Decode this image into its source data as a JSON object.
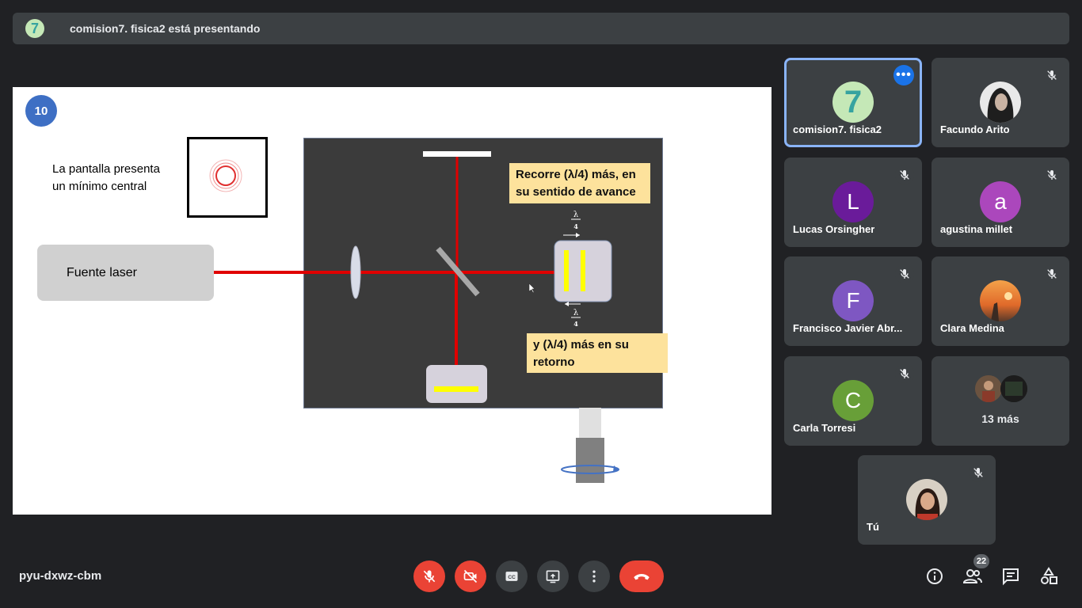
{
  "presenting_bar": {
    "text": "comision7. fisica2 está presentando",
    "avatar_icon": "comision7-logo-icon"
  },
  "slide": {
    "number": "10",
    "screen_text_line1": "La pantalla presenta",
    "screen_text_line2": "un mínimo central",
    "laser_label": "Fuente  laser",
    "callout1_line1": "Recorre (λ/4) más, en",
    "callout1_line2": "su sentido de avance",
    "callout2_line1": "y (λ/4) más en su",
    "callout2_line2": "retorno",
    "lambda_top_num": "λ",
    "lambda_top_den": "4",
    "lambda_bottom_num": "λ",
    "lambda_bottom_den": "4",
    "colors": {
      "laser": "#e00000",
      "panel": "#3b3b3b",
      "mirror": "#ffff00",
      "callout": "#fde29c"
    }
  },
  "participants": [
    {
      "name": "comision7. fisica2",
      "avatar": "7",
      "avatar_color": "#c5e8b7",
      "active": true,
      "more_options": "•••"
    },
    {
      "name": "Facundo Arito",
      "avatar": "",
      "avatar_color": "#2a2a2a",
      "muted": true
    },
    {
      "name": "Lucas Orsingher",
      "avatar": "L",
      "avatar_color": "#6a1b9a",
      "muted": true
    },
    {
      "name": "agustina millet",
      "avatar": "a",
      "avatar_color": "#ab47bc",
      "muted": true
    },
    {
      "name": "Francisco Javier Abr...",
      "avatar": "F",
      "avatar_color": "#7e57c2",
      "muted": true
    },
    {
      "name": "Clara Medina",
      "avatar": "",
      "avatar_color": "#e07b39",
      "muted": true
    },
    {
      "name": "Carla Torresi",
      "avatar": "C",
      "avatar_color": "#689f38",
      "muted": true
    },
    {
      "name": "13 más"
    },
    {
      "name": "Tú",
      "avatar": "",
      "avatar_color": "#8d6e63",
      "muted": true
    }
  ],
  "bottom_bar": {
    "meeting_code": "pyu-dxwz-cbm",
    "participant_count": "22",
    "controls": [
      "mic-off-icon",
      "camera-off-icon",
      "captions-icon",
      "present-icon",
      "more-vert-icon",
      "hangup-icon"
    ],
    "right_controls": [
      "info-icon",
      "people-icon",
      "chat-icon",
      "activities-icon"
    ]
  }
}
